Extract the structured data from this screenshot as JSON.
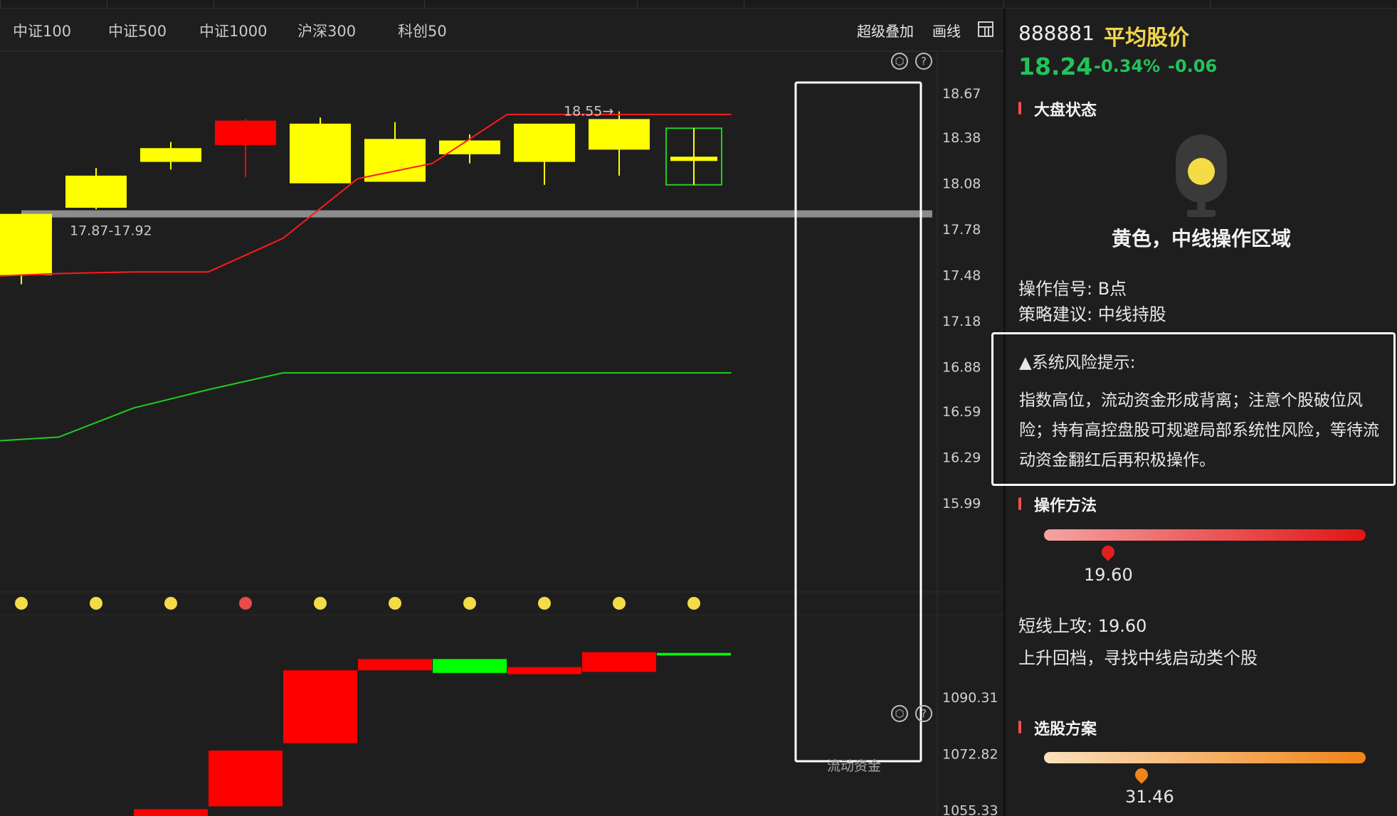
{
  "tabs": [
    "中证100",
    "中证500",
    "中证1000",
    "沪深300",
    "科创50"
  ],
  "toolbar": {
    "overlay": "超级叠加",
    "draw": "画线"
  },
  "stock": {
    "code": "888881",
    "name": "平均股价",
    "price": "18.24",
    "pct": "-0.34%",
    "change": "-0.06"
  },
  "market_status": {
    "title": "大盘状态",
    "light_color": "#f4dc47",
    "text": "黄色，中线操作区域",
    "signal": "操作信号: B点",
    "advice": "策略建议: 中线持股"
  },
  "risk": {
    "title": "▲系统风险提示:",
    "body": "指数高位，流动资金形成背离；注意个股破位风险；持有高控盘股可规避局部系统性风险，等待流动资金翻红后再积极操作。"
  },
  "method": {
    "title": "操作方法",
    "pin_value": "19.60",
    "line1": "短线上攻: 19.60",
    "line2": "上升回档，寻找中线启动类个股"
  },
  "selection": {
    "title": "选股方案",
    "pin_value": "31.46"
  },
  "chart_data": {
    "type": "candlestick",
    "y_ticks": [
      "18.67",
      "18.38",
      "18.08",
      "17.78",
      "17.48",
      "17.18",
      "16.88",
      "16.59",
      "16.29",
      "15.99"
    ],
    "ylim": [
      15.71,
      18.86
    ],
    "candles": [
      {
        "o": 17.48,
        "c": 17.88,
        "h": 17.88,
        "l": 17.42,
        "color": "#ffff00",
        "fill": true
      },
      {
        "o": 17.92,
        "c": 18.13,
        "h": 18.18,
        "l": 17.91,
        "color": "#ffff00",
        "fill": true
      },
      {
        "o": 18.22,
        "c": 18.31,
        "h": 18.35,
        "l": 18.17,
        "color": "#ffff00",
        "fill": true
      },
      {
        "o": 18.49,
        "c": 18.33,
        "h": 18.5,
        "l": 18.12,
        "color": "#ff0000",
        "fill": true
      },
      {
        "o": 18.08,
        "c": 18.47,
        "h": 18.51,
        "l": 18.08,
        "color": "#ffff00",
        "fill": true
      },
      {
        "o": 18.09,
        "c": 18.37,
        "h": 18.48,
        "l": 18.09,
        "color": "#ffff00",
        "fill": true
      },
      {
        "o": 18.27,
        "c": 18.36,
        "h": 18.4,
        "l": 18.21,
        "color": "#ffff00",
        "fill": true
      },
      {
        "o": 18.22,
        "c": 18.47,
        "h": 18.47,
        "l": 18.07,
        "color": "#ffff00",
        "fill": true
      },
      {
        "o": 18.3,
        "c": 18.5,
        "h": 18.55,
        "l": 18.13,
        "color": "#ffff00",
        "fill": true
      },
      {
        "o": 18.44,
        "c": 18.07,
        "h": 18.44,
        "l": 18.07,
        "color": "#22cc22",
        "fill": false
      }
    ],
    "red_line": [
      17.47,
      17.49,
      17.5,
      17.5,
      17.72,
      18.11,
      18.21,
      18.53,
      18.53,
      18.53,
      18.53
    ],
    "green_line": [
      16.39,
      16.42,
      16.61,
      16.73,
      16.84,
      16.84,
      16.84,
      16.84,
      16.84,
      16.84,
      16.84
    ],
    "support_line": 17.88,
    "support_label": "17.87-17.92",
    "high_label": "18.55→",
    "dots": [
      "#f4dc47",
      "#f4dc47",
      "#f4dc47",
      "#e84b4b",
      "#f4dc47",
      "#f4dc47",
      "#f4dc47",
      "#f4dc47",
      "#f4dc47",
      "#f4dc47"
    ],
    "flow_label": "流动资金",
    "flow_ticks": [
      "1090.31",
      "1072.82",
      "1055.33"
    ],
    "flow_ylim": [
      1053.5,
      1114.2
    ],
    "flow_bars": [
      {
        "top": 1055.6,
        "bottom": 1053.5,
        "color": "#ff0000"
      },
      {
        "top": 1073.8,
        "bottom": 1056.5,
        "color": "#ff0000"
      },
      {
        "top": 1098.7,
        "bottom": 1076.1,
        "color": "#ff0000"
      },
      {
        "top": 1102.2,
        "bottom": 1098.7,
        "color": "#ff0000"
      },
      {
        "top": 1102.2,
        "bottom": 1097.9,
        "color": "#00ff00"
      },
      {
        "top": 1099.7,
        "bottom": 1097.5,
        "color": "#ff0000"
      },
      {
        "top": 1104.3,
        "bottom": 1098.2,
        "color": "#ff0000"
      },
      {
        "top": 1104.1,
        "bottom": 1103.3,
        "color": "#00ff00"
      }
    ]
  }
}
